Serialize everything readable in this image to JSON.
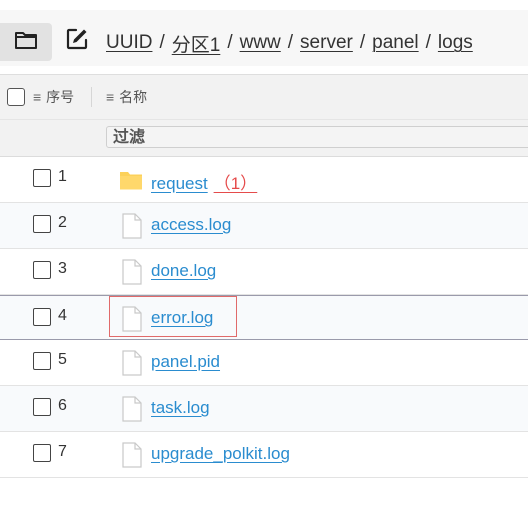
{
  "path_bar": {
    "folder_icon": "folder-icon",
    "edit_icon": "edit-icon",
    "breadcrumbs": [
      "UUID",
      "分区1",
      "www",
      "server",
      "panel",
      "logs"
    ],
    "separator": "/"
  },
  "table": {
    "columns": {
      "index": "序号",
      "name": "名称"
    },
    "filter_placeholder": "过滤",
    "rows": [
      {
        "index": "1",
        "name": "request",
        "count": "（1）",
        "icon": "folder-icon"
      },
      {
        "index": "2",
        "name": "access.log",
        "icon": "file-icon"
      },
      {
        "index": "3",
        "name": "done.log",
        "icon": "file-icon"
      },
      {
        "index": "4",
        "name": "error.log",
        "icon": "file-icon",
        "highlighted": true
      },
      {
        "index": "5",
        "name": "panel.pid",
        "icon": "file-icon"
      },
      {
        "index": "6",
        "name": "task.log",
        "icon": "file-icon"
      },
      {
        "index": "7",
        "name": "upgrade_polkit.log",
        "icon": "file-icon"
      }
    ]
  },
  "colors": {
    "link": "#2a8ccf",
    "count": "#e54b4b",
    "highlight_box": "#e06a6a",
    "folder": "#fcd15a"
  }
}
